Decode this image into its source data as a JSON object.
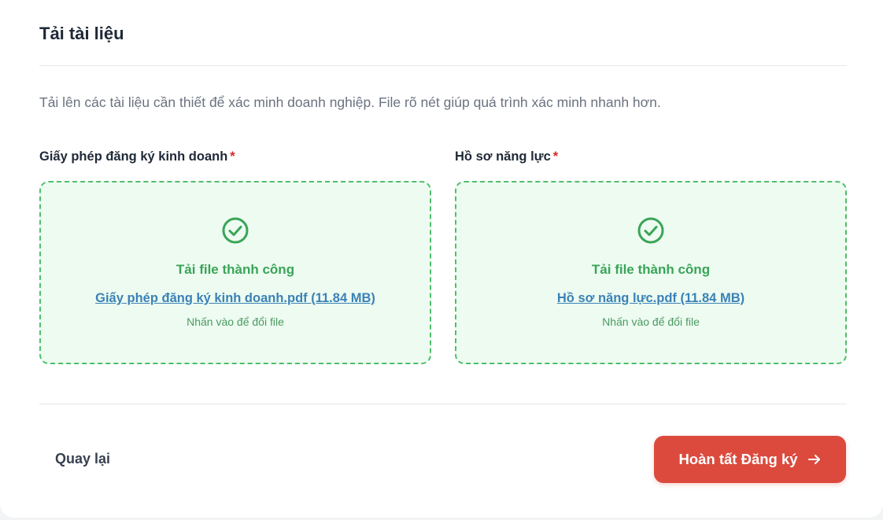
{
  "page": {
    "title": "Tải tài liệu",
    "description": "Tải lên các tài liệu cần thiết để xác minh doanh nghiệp. File rõ nét giúp quá trình xác minh nhanh hơn."
  },
  "uploads": [
    {
      "label": "Giấy phép đăng ký kinh doanh",
      "required_mark": "*",
      "status": "Tải file thành công",
      "file_name": "Giấy phép đăng ký kinh doanh.pdf (11.84 MB)",
      "hint": "Nhấn vào để đổi file"
    },
    {
      "label": "Hồ sơ năng lực",
      "required_mark": "*",
      "status": "Tải file thành công",
      "file_name": "Hồ sơ năng lực.pdf (11.84 MB)",
      "hint": "Nhấn vào để đổi file"
    }
  ],
  "footer": {
    "back_label": "Quay lại",
    "submit_label": "Hoàn tất Đăng ký",
    "submit_icon": "arrow-right-icon"
  },
  "colors": {
    "success": "#3aa457",
    "success_bg": "#edfbf1",
    "link": "#3b82b6",
    "required": "#dc2626",
    "primary_button": "#dc4a3d"
  }
}
